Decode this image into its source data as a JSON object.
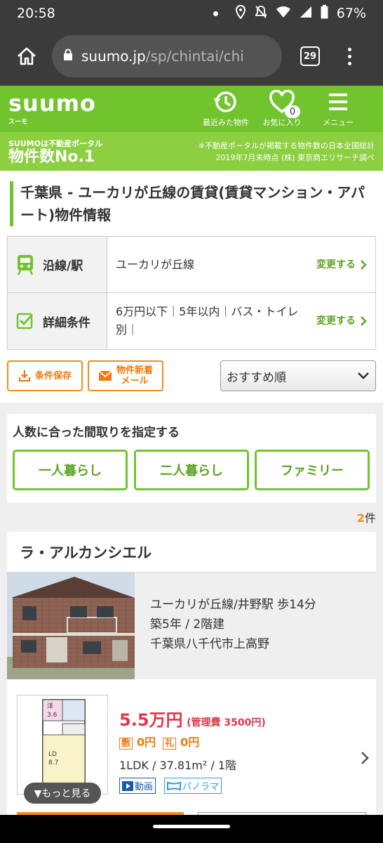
{
  "status_bar": {
    "time": "20:58",
    "battery": "67%"
  },
  "browser": {
    "url_host": "suumo.jp",
    "url_path": "/sp/chintai/chi",
    "tab_count": "29"
  },
  "header": {
    "logo": "suumo",
    "logo_kana": "スーモ",
    "recent_label": "最近みた物件",
    "favorites_label": "お気に入り",
    "favorites_count": "0",
    "menu_label": "メニュー"
  },
  "banner": {
    "line1": "SUUMOは不動産ポータル",
    "line2": "物件数No.1",
    "note1": "※不動産ポータルが掲載する物件数の日本全国総計",
    "note2": "2019年7月末時点 (株) 東京商エリサーチ調べ"
  },
  "page_title": "千葉県 - ユーカリが丘線の賃貸(賃貸マンション・アパート)物件情報",
  "conditions": [
    {
      "label": "沿線/駅",
      "value": "ユーカリが丘線",
      "link": "変更する"
    },
    {
      "label": "詳細条件",
      "value": "6万円以下｜5年以内｜バス・トイレ別｜",
      "link": "変更する"
    }
  ],
  "actions": {
    "save_label": "条件保存",
    "mail_label_1": "物件新着",
    "mail_label_2": "メール",
    "sort_value": "おすすめ順"
  },
  "household": {
    "title": "人数に合った間取りを指定する",
    "options": [
      "一人暮らし",
      "二人暮らし",
      "ファミリー"
    ]
  },
  "result_count": "2",
  "result_unit": "件",
  "listing": {
    "name": "ラ・アルカンシエル",
    "access": "ユーカリが丘線/井野駅 歩14分",
    "age_floors": "築5年 / 2階建",
    "address": "千葉県八千代市上高野",
    "rent": "5.5万円",
    "management": "(管理費 3500円)",
    "deposit_tag": "敷",
    "deposit": "0円",
    "key_money_tag": "礼",
    "key_money": "0円",
    "layout": "1LDK /  37.81m² /  1階",
    "more_label": "▼もっと見る",
    "video_label": "動画",
    "panorama_label": "パノラマ",
    "plan_room1": "洋",
    "plan_room1_size": "3.6",
    "plan_room2": "LD",
    "plan_room2_size": "8.7"
  },
  "colors": {
    "brand_green": "#72c42e",
    "accent_orange": "#f28b1f",
    "price_red": "#e0384b"
  }
}
